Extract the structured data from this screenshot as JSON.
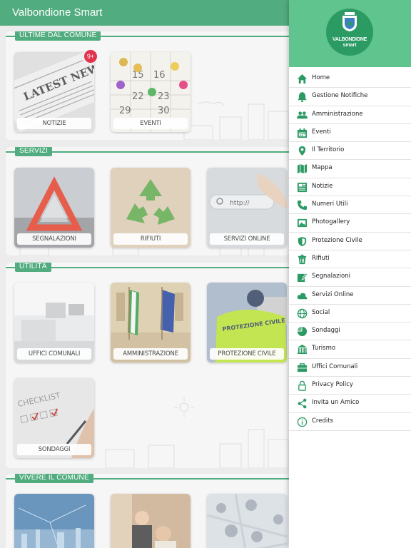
{
  "app": {
    "title": "Valbondione Smart"
  },
  "sections": {
    "ultime": {
      "label": "ULTIME DAL COMUNE",
      "tiles": [
        {
          "label": "NOTIZIE",
          "badge": "9+"
        },
        {
          "label": "EVENTI"
        }
      ]
    },
    "servizi": {
      "label": "SERVIZI",
      "tiles": [
        {
          "label": "SEGNALAZIONI"
        },
        {
          "label": "RIFIUTI"
        },
        {
          "label": "SERVIZI ONLINE",
          "art_text": "http://"
        }
      ]
    },
    "utilita": {
      "label": "UTILITÀ",
      "tiles": [
        {
          "label": "UFFICI COMUNALI"
        },
        {
          "label": "AMMINISTRAZIONE"
        },
        {
          "label": "PROTEZIONE CIVILE",
          "art_text": "PROTEZIONE CIVILE"
        },
        {
          "label": "SONDAGGI"
        }
      ]
    },
    "vivere": {
      "label": "VIVERE IL COMUNE"
    }
  },
  "news_art_text": "LATEST NEWS",
  "checklist_art_text": "CHECKLIST",
  "calendar_art_numbers": [
    "15",
    "16",
    "22",
    "23",
    "29",
    "30"
  ],
  "drawer": {
    "logo": {
      "line1": "VALBONDIONE",
      "line2": "smart"
    },
    "menu": [
      {
        "label": "Home",
        "icon": "home-icon"
      },
      {
        "label": "Gestione Notifiche",
        "icon": "bell-icon"
      },
      {
        "label": "Amministrazione",
        "icon": "people-icon"
      },
      {
        "label": "Eventi",
        "icon": "calendar-icon"
      },
      {
        "label": "Il Territorio",
        "icon": "location-pin-icon"
      },
      {
        "label": "Mappa",
        "icon": "map-icon"
      },
      {
        "label": "Notizie",
        "icon": "newspaper-icon"
      },
      {
        "label": "Numeri Utili",
        "icon": "phone-icon"
      },
      {
        "label": "Photogallery",
        "icon": "photo-icon"
      },
      {
        "label": "Protezione Civile",
        "icon": "shield-icon"
      },
      {
        "label": "Rifiuti",
        "icon": "trash-icon"
      },
      {
        "label": "Segnalazioni",
        "icon": "pencil-note-icon"
      },
      {
        "label": "Servizi Online",
        "icon": "cloud-icon"
      },
      {
        "label": "Social",
        "icon": "globe-icon"
      },
      {
        "label": "Sondaggi",
        "icon": "pie-chart-icon"
      },
      {
        "label": "Turismo",
        "icon": "museum-icon"
      },
      {
        "label": "Uffici Comunali",
        "icon": "briefcase-icon"
      },
      {
        "label": "Privacy Policy",
        "icon": "lock-icon"
      },
      {
        "label": "Invita un Amico",
        "icon": "share-icon"
      },
      {
        "label": "Credits",
        "icon": "info-icon"
      }
    ]
  },
  "colors": {
    "primary": "#2b9a63",
    "drawer_header": "#5fc48e",
    "badge": "#e0344d",
    "icon": "#2b9a63"
  }
}
